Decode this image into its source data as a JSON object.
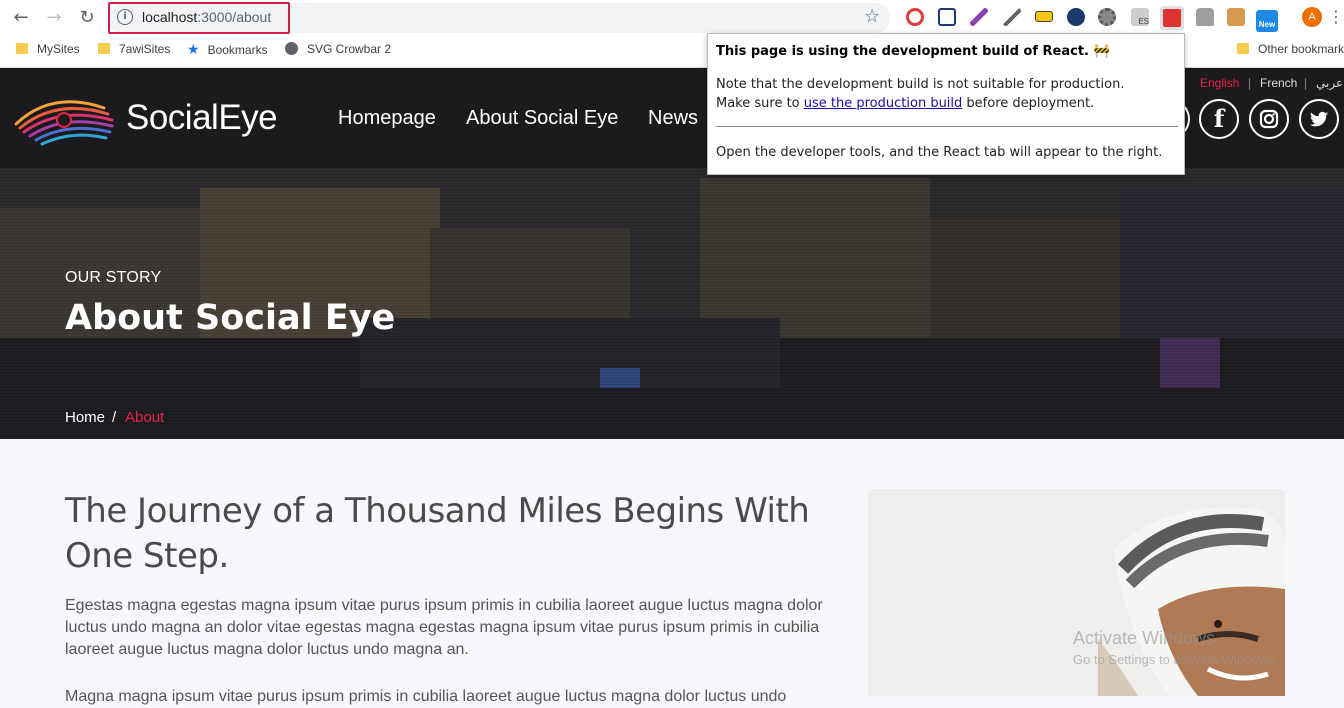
{
  "browser": {
    "url_host": "localhost",
    "url_path": ":3000/about",
    "back_glyph": "←",
    "forward_glyph": "→",
    "reload_glyph": "↻",
    "info_glyph": "i",
    "star_glyph": "☆",
    "menu_glyph": "⋮",
    "profile_initial": "A",
    "extension_badge_new": "New",
    "extension_badge_es": "ES"
  },
  "bookmarks": [
    "MySites",
    "7awiSites",
    "Bookmarks",
    "SVG Crowbar 2"
  ],
  "bookmarks_other": "Other bookmarks",
  "site": {
    "logo_text": "SocialEye",
    "nav": [
      "Homepage",
      "About Social Eye",
      "News"
    ],
    "languages": [
      "English",
      "French",
      "عربي"
    ],
    "language_separator": "|",
    "social_icons": [
      "twitter-icon",
      "instagram-icon",
      "facebook-icon"
    ],
    "social_glyphs": {
      "facebook": "f"
    }
  },
  "hero": {
    "eyebrow": "OUR STORY",
    "title": "About Social Eye",
    "breadcrumb_home": "Home",
    "breadcrumb_separator": "/",
    "breadcrumb_current": "About"
  },
  "content": {
    "heading": "The Journey of a Thousand Miles Begins With One Step.",
    "paragraph1": "Egestas magna egestas magna ipsum vitae purus ipsum primis in cubilia laoreet augue luctus magna dolor luctus undo magna an dolor vitae egestas magna egestas magna ipsum vitae purus ipsum primis in cubilia laoreet augue luctus magna dolor luctus undo magna an.",
    "paragraph2": "Magna magna ipsum vitae purus ipsum primis in cubilia laoreet augue luctus magna dolor luctus undo"
  },
  "watermark": {
    "title": "Activate Windows",
    "subtitle": "Go to Settings to activate Windows."
  },
  "react_popup": {
    "title": "This page is using the development build of React. 🚧",
    "line1": "Note that the development build is not suitable for production.",
    "line2_prefix": "Make sure to ",
    "line2_link": "use the production build",
    "line2_suffix": " before deployment.",
    "line3": "Open the developer tools, and the React tab will appear to the right."
  },
  "colors": {
    "accent": "#e8214b",
    "header_bg": "#1b1b1d",
    "url_highlight": "#d21f4a"
  }
}
